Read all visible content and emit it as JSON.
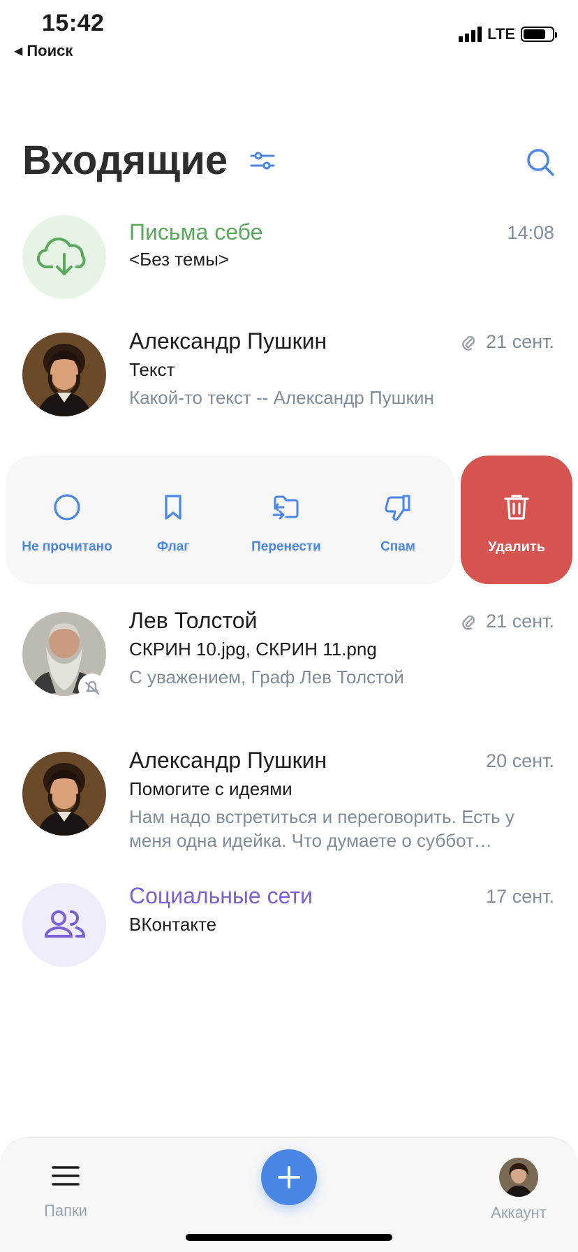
{
  "status_bar": {
    "time": "15:42",
    "back_label": "Поиск",
    "network": "LTE"
  },
  "header": {
    "title": "Входящие"
  },
  "messages": [
    {
      "sender": "Письма себе",
      "sender_color": "#5aa85a",
      "date": "14:08",
      "subject": "<Без темы>",
      "preview": "",
      "avatar": "download-icon",
      "has_attachment": false
    },
    {
      "sender": "Александр Пушкин",
      "date": "21 сент.",
      "subject": "Текст",
      "preview": "Какой-то текст -- Александр Пушкин",
      "avatar": "portrait-pushkin",
      "has_attachment": true
    },
    {
      "sender": "Лев Толстой",
      "date": "21 сент.",
      "subject": "СКРИН 10.jpg, СКРИН 11.png",
      "preview": "С уважением, Граф Лев Толстой",
      "avatar": "portrait-tolstoy",
      "has_attachment": true,
      "muted": true
    },
    {
      "sender": "Александр Пушкин",
      "date": "20 сент.",
      "subject": "Помогите с идеями",
      "preview": "Нам надо встретиться и переговорить. Есть у меня одна идейка. Что думаете о суббот…",
      "avatar": "portrait-pushkin",
      "has_attachment": false
    },
    {
      "sender": "Социальные сети",
      "sender_color": "#7a5fd6",
      "date": "17 сент.",
      "subject": "ВКонтакте",
      "preview": "",
      "avatar": "people-icon",
      "has_attachment": false
    }
  ],
  "swipe_actions": {
    "unread": "Не прочитано",
    "flag": "Флаг",
    "move": "Перенести",
    "spam": "Спам",
    "delete": "Удалить"
  },
  "tabbar": {
    "folders": "Папки",
    "account": "Аккаунт"
  },
  "colors": {
    "accent": "#4986e6",
    "delete": "#d6534f",
    "secondary_text": "#818c99"
  }
}
